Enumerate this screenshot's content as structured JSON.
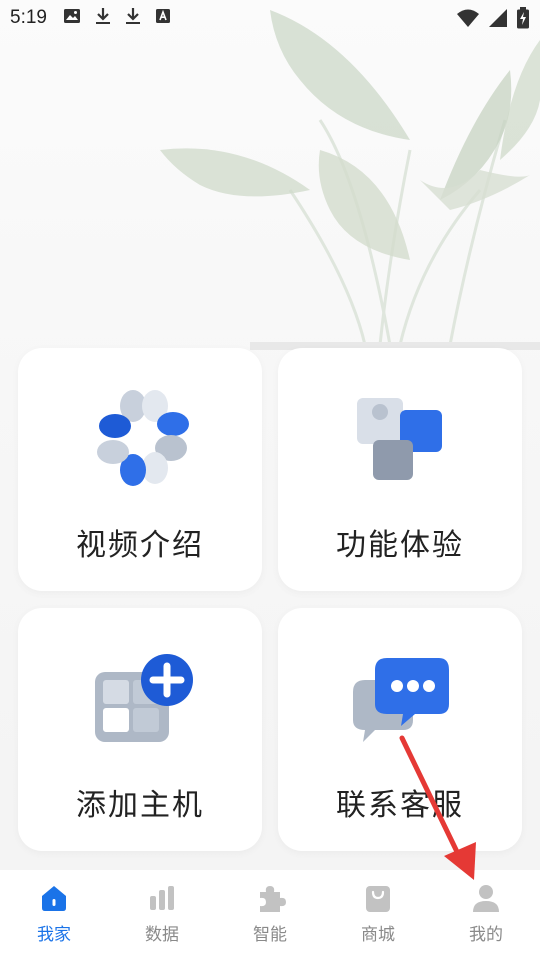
{
  "status_bar": {
    "time": "5:19",
    "left_icons": [
      "image-icon",
      "download-icon",
      "download-icon",
      "text-icon"
    ],
    "right_icons": [
      "wifi-icon",
      "signal-icon",
      "battery-charging-icon"
    ]
  },
  "cards": [
    {
      "label": "视频介绍",
      "icon": "video-intro-icon"
    },
    {
      "label": "功能体验",
      "icon": "feature-experience-icon"
    },
    {
      "label": "添加主机",
      "icon": "add-host-icon"
    },
    {
      "label": "联系客服",
      "icon": "customer-service-icon"
    }
  ],
  "tabbar": {
    "items": [
      {
        "label": "我家",
        "icon": "home-icon",
        "active": true
      },
      {
        "label": "数据",
        "icon": "bar-chart-icon",
        "active": false
      },
      {
        "label": "智能",
        "icon": "puzzle-icon",
        "active": false
      },
      {
        "label": "商城",
        "icon": "shopping-bag-icon",
        "active": false
      },
      {
        "label": "我的",
        "icon": "user-icon",
        "active": false
      }
    ]
  },
  "colors": {
    "accent": "#1a73e8",
    "inactive": "#8a8a8a",
    "annotation_arrow": "#e53935"
  }
}
